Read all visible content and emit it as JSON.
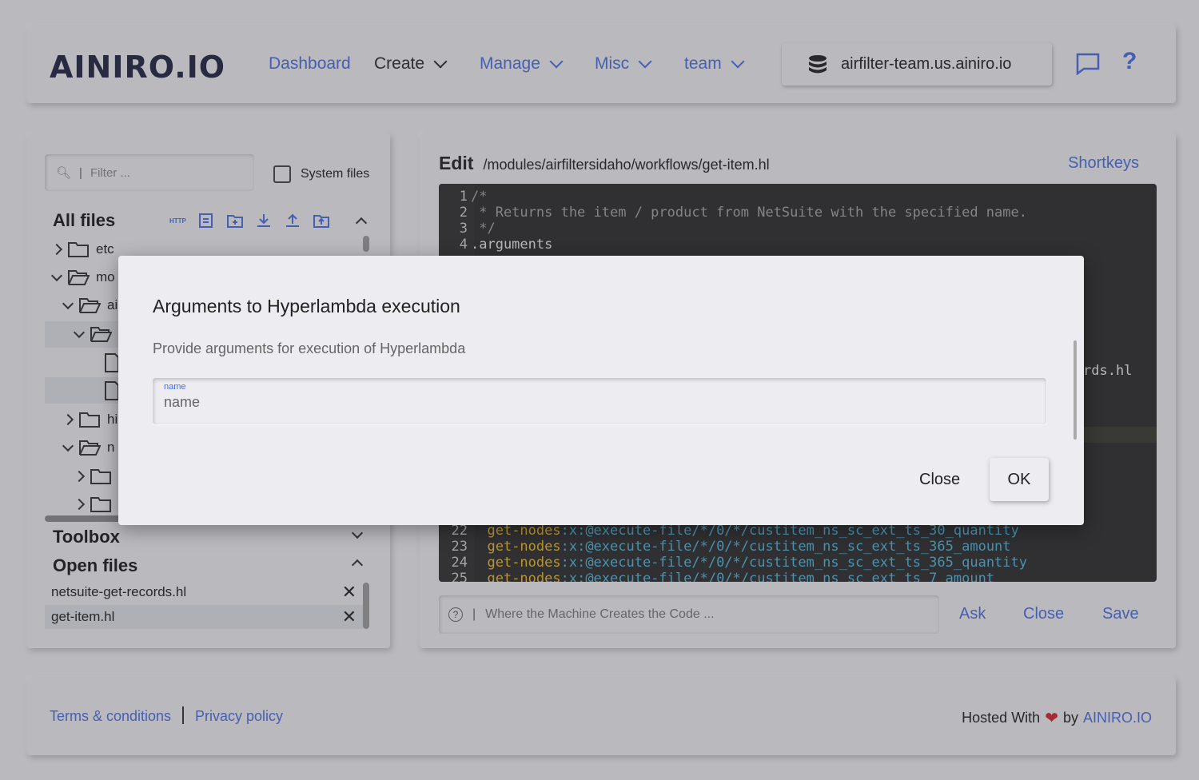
{
  "header": {
    "logo": "AINIRO.IO",
    "nav": {
      "dashboard": "Dashboard",
      "create": "Create",
      "manage": "Manage",
      "misc": "Misc",
      "team": "team"
    },
    "server": "airfilter-team.us.ainiro.io"
  },
  "sidebar": {
    "filter_placeholder": "Filter ...",
    "system_files": "System files",
    "all_files": "All files",
    "tree": [
      {
        "label": "etc"
      },
      {
        "label": "mo"
      },
      {
        "label": "ai"
      },
      {
        "label": "hi"
      },
      {
        "label": "n"
      }
    ],
    "toolbox": "Toolbox",
    "open_files_title": "Open files",
    "open_files": [
      {
        "label": "netsuite-get-records.hl"
      },
      {
        "label": "get-item.hl"
      }
    ]
  },
  "editor": {
    "title": "Edit",
    "path": "/modules/airfiltersidaho/workflows/get-item.hl",
    "shortkeys": "Shortkeys",
    "lines_top": [
      {
        "n": "1",
        "t": "/*"
      },
      {
        "n": "2",
        "t": " * Returns the item / product from NetSuite with the specified name."
      },
      {
        "n": "3",
        "t": " */"
      },
      {
        "n": "4",
        "t": ".arguments"
      }
    ],
    "partial_text": "rds.hl",
    "lines_bottom": [
      {
        "n": "22",
        "k": "get-nodes",
        "e": ":x:@execute-file/*/0/*/custitem_ns_sc_ext_ts_30_quantity"
      },
      {
        "n": "23",
        "k": "get-nodes",
        "e": ":x:@execute-file/*/0/*/custitem_ns_sc_ext_ts_365_amount"
      },
      {
        "n": "24",
        "k": "get-nodes",
        "e": ":x:@execute-file/*/0/*/custitem_ns_sc_ext_ts_365_quantity"
      },
      {
        "n": "25",
        "k": "get-nodes",
        "e": ":x:@execute-file/*/0/*/custitem_ns_sc_ext_ts_7_amount"
      }
    ],
    "ask_placeholder": "Where the Machine Creates the Code ...",
    "ask_label": "Ask",
    "close_label": "Close",
    "save_label": "Save"
  },
  "footer": {
    "terms": "Terms & conditions",
    "privacy": "Privacy policy",
    "hosted_with": "Hosted With",
    "by": "by",
    "brand": "AINIRO.IO"
  },
  "dialog": {
    "title": "Arguments to Hyperlambda execution",
    "subtitle": "Provide arguments for execution of Hyperlambda",
    "field_label": "name",
    "field_placeholder": "name",
    "close": "Close",
    "ok": "OK"
  },
  "colors": {
    "accent": "#4a6ddb",
    "background": "#e9e9ee",
    "code_bg": "#2b2b2b"
  }
}
